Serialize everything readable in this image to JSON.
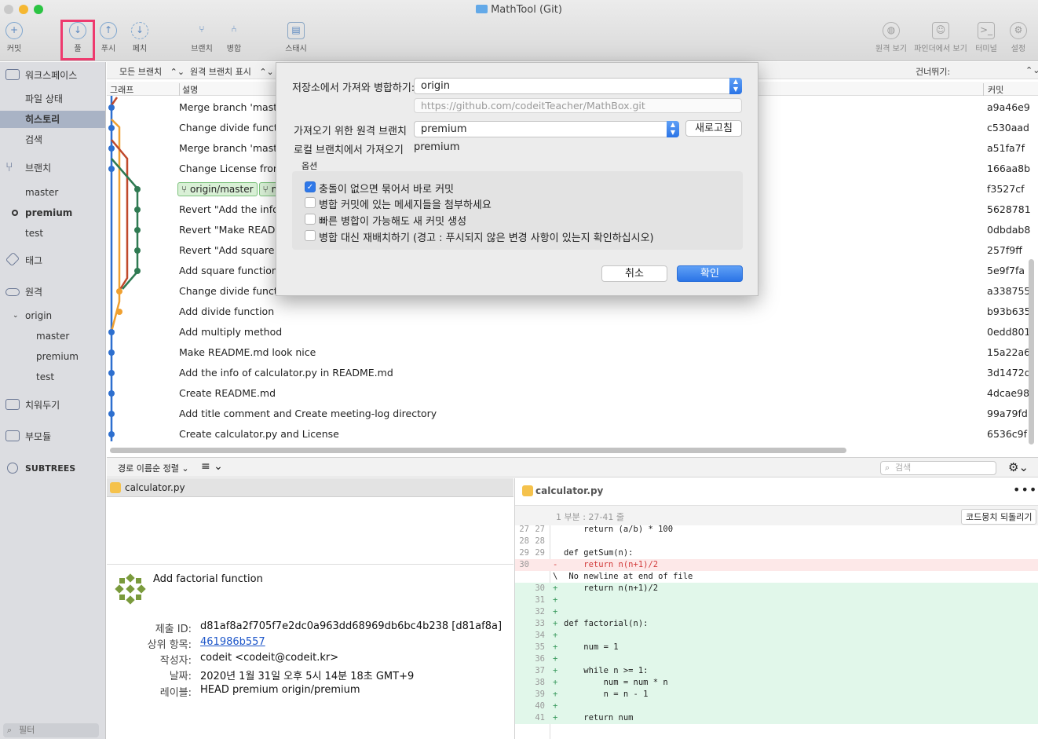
{
  "window": {
    "title": "MathTool (Git)"
  },
  "toolbar": {
    "commit": "커밋",
    "pull": "풀",
    "push": "푸시",
    "fetch": "페치",
    "branch": "브랜치",
    "merge": "병합",
    "stash": "스태시",
    "remote_view": "원격 보기",
    "finder_view": "파인더에서 보기",
    "terminal": "터미널",
    "settings": "설정"
  },
  "sidebar": {
    "workspace": "워크스페이스",
    "file_status": "파일 상태",
    "history": "히스토리",
    "search": "검색",
    "branches": "브랜치",
    "branch_items": [
      "master",
      "premium",
      "test"
    ],
    "tags": "태그",
    "remotes": "원격",
    "origin": "origin",
    "origin_items": [
      "master",
      "premium",
      "test"
    ],
    "stashes": "치워두기",
    "submodules": "부모듈",
    "subtrees": "SUBTREES",
    "filter": "필터"
  },
  "history_header": {
    "all_branches": "모든 브랜치",
    "show_remote": "원격 브랜치 표시",
    "skip": "건너뛰기:"
  },
  "columns": {
    "graph": "그래프",
    "description": "설명",
    "commit": "커밋"
  },
  "commits": [
    {
      "msg": "Merge branch 'master",
      "hash": "a9a46e9"
    },
    {
      "msg": "Change divide functio",
      "hash": "c530aad"
    },
    {
      "msg": "Merge branch 'master",
      "hash": "a51fa7f"
    },
    {
      "msg": "Change License from",
      "hash": "166aa8b"
    },
    {
      "msg": "",
      "hash": "f3527cf"
    },
    {
      "msg": "Revert \"Add the info o",
      "hash": "5628781"
    },
    {
      "msg": "Revert \"Make READMI",
      "hash": "0dbdab8"
    },
    {
      "msg": "Revert \"Add square fu",
      "hash": "257f9ff"
    },
    {
      "msg": "Add square function",
      "hash": "5e9f7fa"
    },
    {
      "msg": "Change divide functio",
      "hash": "a338755"
    },
    {
      "msg": "Add divide function",
      "hash": "b93b635"
    },
    {
      "msg": "Add multiply method",
      "hash": "0edd801"
    },
    {
      "msg": "Make README.md look nice",
      "hash": "15a22a6"
    },
    {
      "msg": "Add the info of calculator.py in README.md",
      "hash": "3d1472d"
    },
    {
      "msg": "Create README.md",
      "hash": "4dcae98"
    },
    {
      "msg": "Add title comment and Create meeting-log directory",
      "hash": "99a79fd"
    },
    {
      "msg": "Create calculator.py and License",
      "hash": "6536c9f"
    }
  ],
  "tags_row": {
    "tag1": "origin/master",
    "tag2": "ma"
  },
  "midbar": {
    "sort": "경로 이름순 정렬",
    "search_placeholder": "검색"
  },
  "left_file": "calculator.py",
  "commit_info": {
    "title": "Add factorial function",
    "labels": [
      "제출 ID:",
      "상위 항목:",
      "작성자:",
      "날짜:",
      "레이블:"
    ],
    "id": "d81af8a2f705f7e2dc0a963dd68969db6bc4b238 [d81af8a]",
    "parent": "461986b557",
    "author": "codeit <codeit@codeit.kr>",
    "date": "2020년 1월 31일 오후 5시 14분 18초 GMT+9",
    "labels_value": "HEAD premium origin/premium"
  },
  "diff": {
    "file": "calculator.py",
    "hunk": "1 부분 : 27-41 줄",
    "revert": "코드뭉치 되돌리기",
    "lines": [
      {
        "n1": "27",
        "n2": "27",
        "s": "",
        "t": "    return (a/b) * 100",
        "k": "ctx"
      },
      {
        "n1": "28",
        "n2": "28",
        "s": "",
        "t": "",
        "k": "ctx"
      },
      {
        "n1": "29",
        "n2": "29",
        "s": "",
        "t": "def getSum(n):",
        "k": "ctx"
      },
      {
        "n1": "30",
        "n2": "",
        "s": "-",
        "t": "    return n(n+1)/2",
        "k": "del"
      },
      {
        "n1": "",
        "n2": "",
        "s": "\\",
        "t": " No newline at end of file",
        "k": "ctx"
      },
      {
        "n1": "",
        "n2": "30",
        "s": "+",
        "t": "    return n(n+1)/2",
        "k": "add"
      },
      {
        "n1": "",
        "n2": "31",
        "s": "+",
        "t": "",
        "k": "add"
      },
      {
        "n1": "",
        "n2": "32",
        "s": "+",
        "t": "",
        "k": "add"
      },
      {
        "n1": "",
        "n2": "33",
        "s": "+",
        "t": "def factorial(n):",
        "k": "add"
      },
      {
        "n1": "",
        "n2": "34",
        "s": "+",
        "t": "",
        "k": "add"
      },
      {
        "n1": "",
        "n2": "35",
        "s": "+",
        "t": "    num = 1",
        "k": "add"
      },
      {
        "n1": "",
        "n2": "36",
        "s": "+",
        "t": "",
        "k": "add"
      },
      {
        "n1": "",
        "n2": "37",
        "s": "+",
        "t": "    while n >= 1:",
        "k": "add"
      },
      {
        "n1": "",
        "n2": "38",
        "s": "+",
        "t": "        num = num * n",
        "k": "add"
      },
      {
        "n1": "",
        "n2": "39",
        "s": "+",
        "t": "        n = n - 1",
        "k": "add"
      },
      {
        "n1": "",
        "n2": "40",
        "s": "+",
        "t": "",
        "k": "add"
      },
      {
        "n1": "",
        "n2": "41",
        "s": "+",
        "t": "    return num",
        "k": "add"
      }
    ]
  },
  "dialog": {
    "repo_label": "저장소에서 가져와 병합하기:",
    "repo_value": "origin",
    "url": "https://github.com/codeitTeacher/MathBox.git",
    "remote_branch_label": "가져오기 위한 원격 브랜치",
    "remote_branch_value": "premium",
    "refresh": "새로고침",
    "local_branch_label": "로컬 브랜치에서 가져오기",
    "local_branch_value": "premium",
    "options_label": "옵션",
    "options": [
      {
        "label": "충돌이 없으면 묶어서 바로 커밋",
        "checked": true
      },
      {
        "label": "병합 커밋에 있는 메세지들을 첨부하세요",
        "checked": false
      },
      {
        "label": "빠른 병합이 가능해도 새 커밋 생성",
        "checked": false
      },
      {
        "label": "병합 대신 재배치하기 (경고 : 푸시되지 않은 변경 사항이 있는지 확인하십시오)",
        "checked": false
      }
    ],
    "cancel": "취소",
    "ok": "확인"
  },
  "colors": {
    "accent": "#2f78e8",
    "highlight": "#ee3a6e",
    "branch_blue": "#2d6fcf",
    "branch_orange": "#f0a030",
    "branch_red": "#c0492c",
    "branch_green": "#2f7a52"
  }
}
